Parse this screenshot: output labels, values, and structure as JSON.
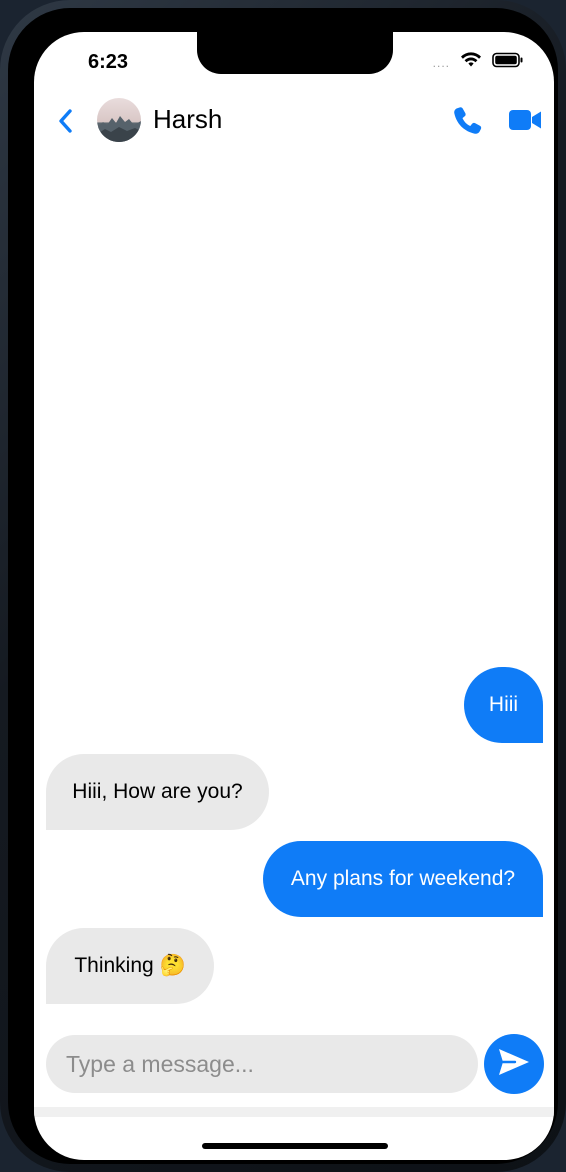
{
  "status_bar": {
    "time": "6:23",
    "signal_dots": "....",
    "icons": [
      "wifi-icon",
      "battery-icon"
    ]
  },
  "header": {
    "contact_name": "Harsh",
    "icons": [
      "back-chevron-icon",
      "phone-icon",
      "video-camera-icon"
    ]
  },
  "messages": [
    {
      "direction": "outgoing",
      "text": "Hiii"
    },
    {
      "direction": "incoming",
      "text": "Hiii, How are you?"
    },
    {
      "direction": "outgoing",
      "text": "Any plans for weekend?"
    },
    {
      "direction": "incoming",
      "text": "Thinking 🤔"
    }
  ],
  "composer": {
    "placeholder": "Type a message...",
    "value": ""
  },
  "colors": {
    "accent": "#0f7cf7",
    "incoming_bubble": "#e9e9e9",
    "background": "#ffffff"
  }
}
